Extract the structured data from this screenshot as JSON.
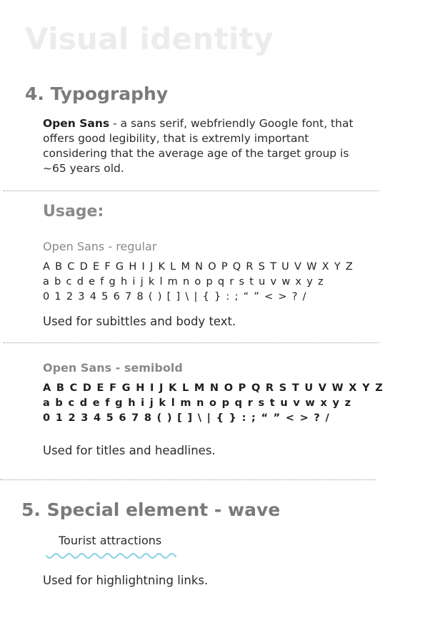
{
  "page_title": "Visual identity",
  "typography": {
    "heading": "4. Typography",
    "font_name": "Open Sans",
    "description": " - a sans serif, webfriendly Google font, that offers good legibility, that is extremly important considering that the average age of the target group is ~65 years old."
  },
  "usage": {
    "heading": "Usage:",
    "regular": {
      "label": "Open Sans - regular",
      "glyph_lines": [
        "A B C D E F G H I J K L M N O P Q R S T U V W X Y Z",
        "a b c d e f g h i j k l m n o p q r s t u v w x y z",
        "0 1 2 3 4 5 6 7 8 ( ) [ ] \\ | { } : ; “ ” < > ? /"
      ],
      "note": "Used for subittles and body text."
    },
    "semibold": {
      "label": "Open Sans - semibold",
      "glyph_lines": [
        "A B C D E F G H I J K L M N O P Q R S T U V W X Y Z",
        "a b c d e f g h i j k l m n o p q r s t u v w x y z",
        "0 1 2 3 4 5 6 7 8 ( ) [ ] \\ | { } : ; “ ” < > ? /"
      ],
      "note": "Used for titles and headlines."
    }
  },
  "special_element": {
    "heading": "5. Special element - wave",
    "demo_link_text": "Tourist attractions",
    "wave_color": "#8fd3e6",
    "note": "Used for highlightning links."
  },
  "colors": {
    "page_title": "#ececec",
    "section_heading": "#7a7a7a",
    "label_gray": "#8a8a8a",
    "body_text": "#2b2b2b",
    "divider": "#9a9a9a"
  }
}
